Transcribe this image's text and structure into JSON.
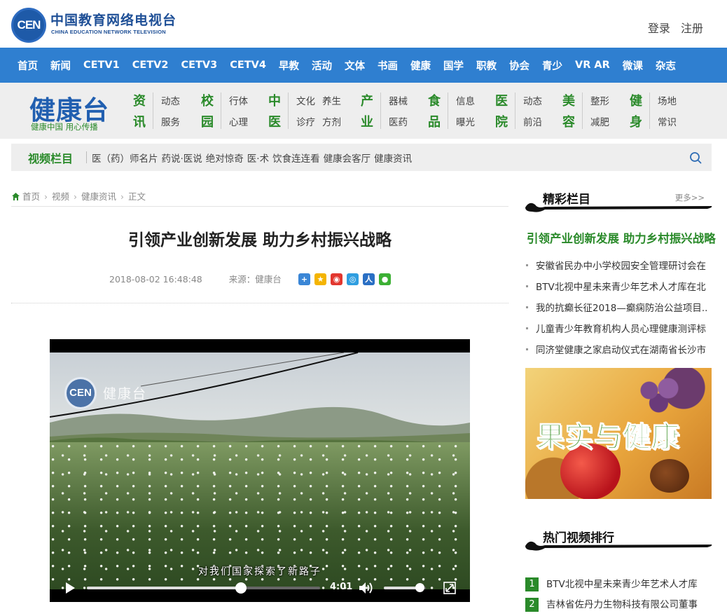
{
  "header": {
    "logo_mark": "CEN",
    "logo_cn": "中国教育网络电视台",
    "logo_en": "CHINA EDUCATION NETWORK TELEVISION",
    "login": "登录",
    "register": "注册"
  },
  "nav": [
    "首页",
    "新闻",
    "CETV1",
    "CETV2",
    "CETV3",
    "CETV4",
    "早教",
    "活动",
    "文体",
    "书画",
    "健康",
    "国学",
    "职教",
    "协会",
    "青少",
    "VR AR",
    "微课",
    "杂志"
  ],
  "channel": {
    "title": "健康台",
    "slogan": "健康中国  用心传播",
    "categories": [
      {
        "h1": "资",
        "h2": "讯",
        "links": [
          "动态",
          "服务"
        ]
      },
      {
        "h1": "校",
        "h2": "园",
        "links": [
          "行体",
          "心理"
        ]
      },
      {
        "h1": "中",
        "h2": "医",
        "links": [
          "文化",
          "养生",
          "诊疗",
          "方剂"
        ]
      },
      {
        "h1": "产",
        "h2": "业",
        "links": [
          "器械",
          "医药"
        ]
      },
      {
        "h1": "食",
        "h2": "品",
        "links": [
          "信息",
          "曝光"
        ]
      },
      {
        "h1": "医",
        "h2": "院",
        "links": [
          "动态",
          "前沿"
        ]
      },
      {
        "h1": "美",
        "h2": "容",
        "links": [
          "整形",
          "减肥"
        ]
      },
      {
        "h1": "健",
        "h2": "身",
        "links": [
          "场地",
          "常识"
        ]
      }
    ]
  },
  "videobar": {
    "title": "视频栏目",
    "links": [
      "医（药）师名片",
      "药说·医说",
      "绝对惊奇",
      "医·术",
      "饮食连连看",
      "健康会客厅",
      "健康资讯"
    ]
  },
  "breadcrumb": [
    "首页",
    "视频",
    "健康资讯",
    "正文"
  ],
  "article": {
    "title": "引领产业创新发展 助力乡村振兴战略",
    "date": "2018-08-02 16:48:48",
    "source": "来源：健康台"
  },
  "video": {
    "watermark_mark": "CEN",
    "watermark_text": "健康台",
    "subtitle": "对我们国家探索了新路子",
    "time": "4:01",
    "progress": 0.66,
    "volume": 0.85
  },
  "sidebar": {
    "featured_title": "精彩栏目",
    "more": "更多>>",
    "featured_headline": "引领产业创新发展 助力乡村振兴战略",
    "list": [
      "安徽省民办中小学校园安全管理研讨会在",
      "BTV北视中星未来青少年艺术人才库在北",
      "我的抗癫长征2018—癫痫防治公益项目..",
      "儿童青少年教育机构人员心理健康测评标",
      "同济堂健康之家启动仪式在湖南省长沙市"
    ],
    "promo_text": "果实与健康",
    "rank_title": "热门视频排行",
    "rank": [
      {
        "num": "1",
        "text": "BTV北视中星未来青少年艺术人才库"
      },
      {
        "num": "2",
        "text": "吉林省佐丹力生物科技有限公司董事"
      }
    ]
  },
  "colors": {
    "nav_blue": "#2f7fd0",
    "accent_green": "#2a8a2a",
    "title_blue": "#215fb0"
  }
}
